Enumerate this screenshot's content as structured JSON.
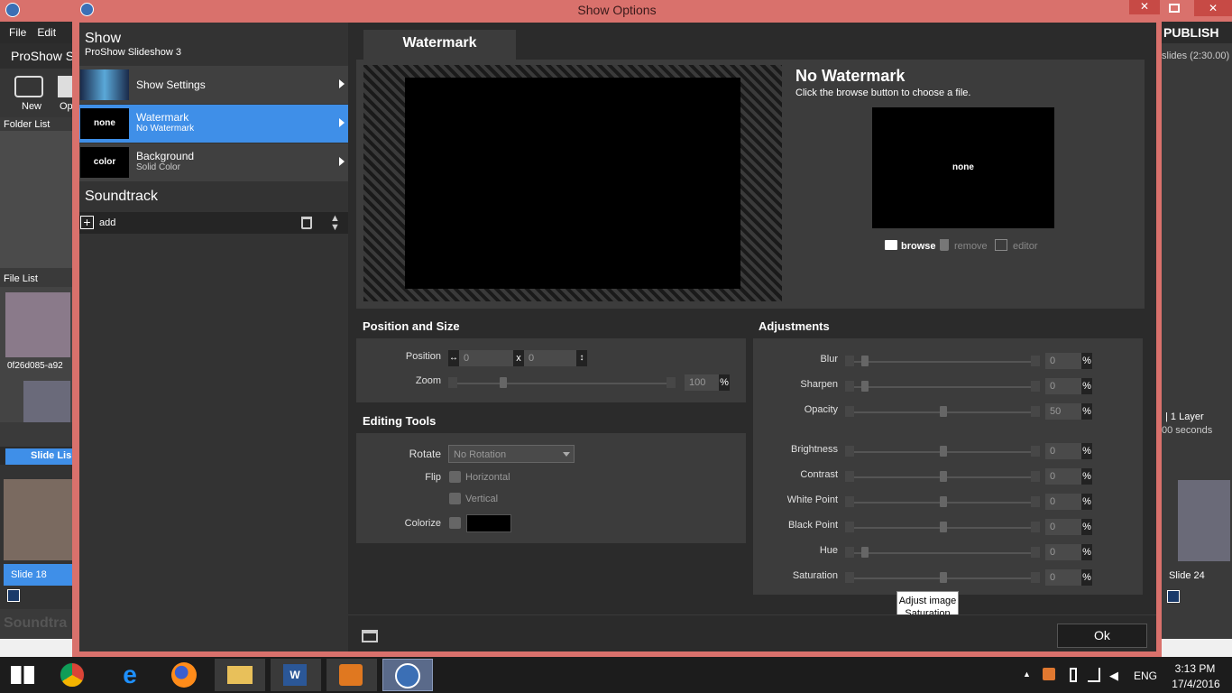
{
  "dialog": {
    "title": "Show Options",
    "close": "✕"
  },
  "background_app": {
    "menu": [
      "File",
      "Edit"
    ],
    "app_name": "ProShow S",
    "toolbar": [
      {
        "label": "New"
      },
      {
        "label": "Op"
      }
    ],
    "folder_list": "Folder List",
    "file_list": "File List",
    "file_name": "0f26d085-a92",
    "slide_list": "Slide Lis",
    "slide_left": "Slide 18",
    "slide_right": "Slide 24",
    "publish": "PUBLISH",
    "slides_info": "slides (2:30.00)",
    "layer_info": "|  1 Layer",
    "seconds_info": "00 seconds",
    "soundtrack": "Soundtra"
  },
  "left": {
    "show_title": "Show",
    "show_sub": "ProShow Slideshow 3",
    "items": [
      {
        "title": "Show Settings",
        "sub": "",
        "thumb": ""
      },
      {
        "title": "Watermark",
        "sub": "No Watermark",
        "thumb": "none"
      },
      {
        "title": "Background",
        "sub": "Solid Color",
        "thumb": "color"
      }
    ],
    "soundtrack_title": "Soundtrack",
    "add_label": "add"
  },
  "tab": {
    "label": "Watermark"
  },
  "watermark": {
    "title": "No Watermark",
    "hint": "Click the browse button to choose a file.",
    "preview_text": "none",
    "browse": "browse",
    "remove": "remove",
    "editor": "editor"
  },
  "position_size": {
    "title": "Position and Size",
    "position_label": "Position",
    "pos_x": "0",
    "pos_sep": "x",
    "pos_y": "0",
    "zoom_label": "Zoom",
    "zoom_value": "100",
    "zoom_level": 0.28,
    "pct": "%"
  },
  "editing": {
    "title": "Editing Tools",
    "rotate_label": "Rotate",
    "rotate_value": "No Rotation",
    "flip_label": "Flip",
    "horizontal": "Horizontal",
    "vertical": "Vertical",
    "colorize_label": "Colorize"
  },
  "adjustments": {
    "title": "Adjustments",
    "rows": [
      {
        "label": "Blur",
        "value": "0",
        "level": 0
      },
      {
        "label": "Sharpen",
        "value": "0",
        "level": 0
      },
      {
        "label": "Opacity",
        "value": "50",
        "level": 0.5
      },
      {
        "label": "Brightness",
        "value": "0",
        "level": 0.5
      },
      {
        "label": "Contrast",
        "value": "0",
        "level": 0.5
      },
      {
        "label": "White Point",
        "value": "0",
        "level": 0.5
      },
      {
        "label": "Black Point",
        "value": "0",
        "level": 0.5
      },
      {
        "label": "Hue",
        "value": "0",
        "level": 0
      },
      {
        "label": "Saturation",
        "value": "0",
        "level": 0.5
      }
    ]
  },
  "tooltip": {
    "line1": "Adjust image",
    "line2": "Saturation"
  },
  "footer": {
    "ok": "Ok"
  },
  "taskbar": {
    "lang": "ENG",
    "time": "3:13 PM",
    "date": "17/4/2016"
  }
}
